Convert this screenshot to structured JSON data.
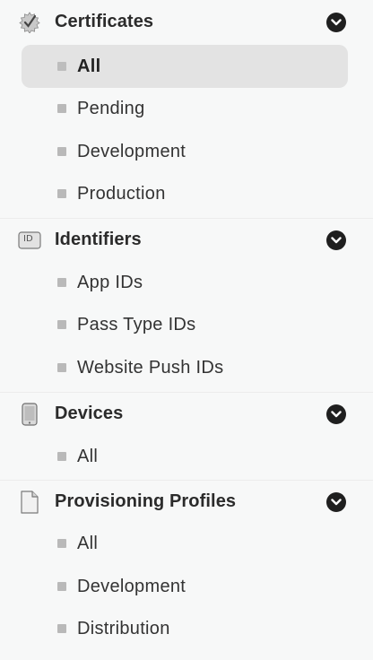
{
  "sidebar": {
    "certificates": {
      "title": "Certificates",
      "icon": "certificate-seal-icon",
      "items": [
        {
          "label": "All",
          "active": true
        },
        {
          "label": "Pending"
        },
        {
          "label": "Development"
        },
        {
          "label": "Production"
        }
      ]
    },
    "identifiers": {
      "title": "Identifiers",
      "icon": "id-badge-icon",
      "icon_text": "ID",
      "items": [
        {
          "label": "App IDs"
        },
        {
          "label": "Pass Type IDs"
        },
        {
          "label": "Website Push IDs"
        }
      ]
    },
    "devices": {
      "title": "Devices",
      "icon": "phone-device-icon",
      "items": [
        {
          "label": "All"
        }
      ]
    },
    "provisioning": {
      "title": "Provisioning Profiles",
      "icon": "document-icon",
      "items": [
        {
          "label": "All"
        },
        {
          "label": "Development"
        },
        {
          "label": "Distribution"
        }
      ]
    }
  },
  "colors": {
    "background": "#f7f8f8",
    "active_item_background": "#e3e3e3",
    "chevron": "#1f1f1f",
    "bullet": "#b9b9b9"
  }
}
